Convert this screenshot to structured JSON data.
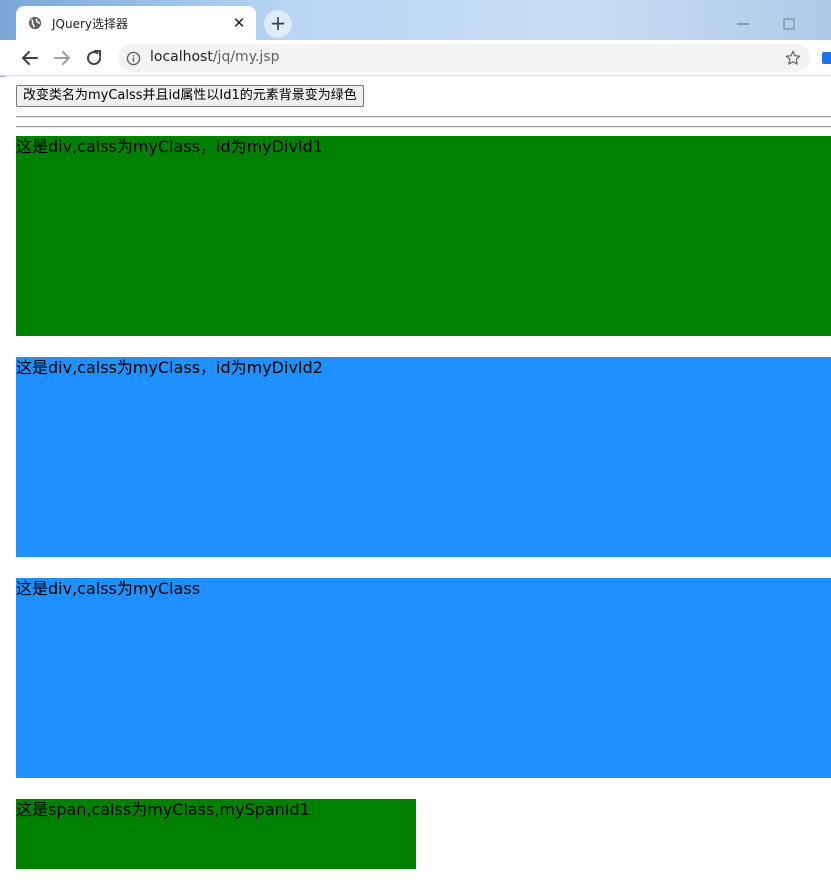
{
  "browser": {
    "tab_title": "JQuery选择器",
    "tab_close": "✕",
    "new_tab": "+",
    "url_host": "localhost",
    "url_path": "/jq/my.jsp"
  },
  "page": {
    "button_label": "改变类名为myCalss并且id属性以Id1的元素背景变为绿色",
    "blocks": [
      {
        "text": "这是div,calss为myClass，id为myDivId1",
        "color": "#008000"
      },
      {
        "text": "这是div,calss为myClass，id为myDivId2",
        "color": "#1e90ff"
      },
      {
        "text": "这是div,calss为myClass",
        "color": "#1e90ff"
      },
      {
        "text": "这是span,calss为myClass,mySpanId1",
        "color": "#008000"
      }
    ]
  },
  "icons": [
    "globe-icon",
    "close-icon",
    "plus-icon",
    "back-icon",
    "forward-icon",
    "reload-icon",
    "info-icon",
    "star-icon",
    "extension-icon"
  ]
}
